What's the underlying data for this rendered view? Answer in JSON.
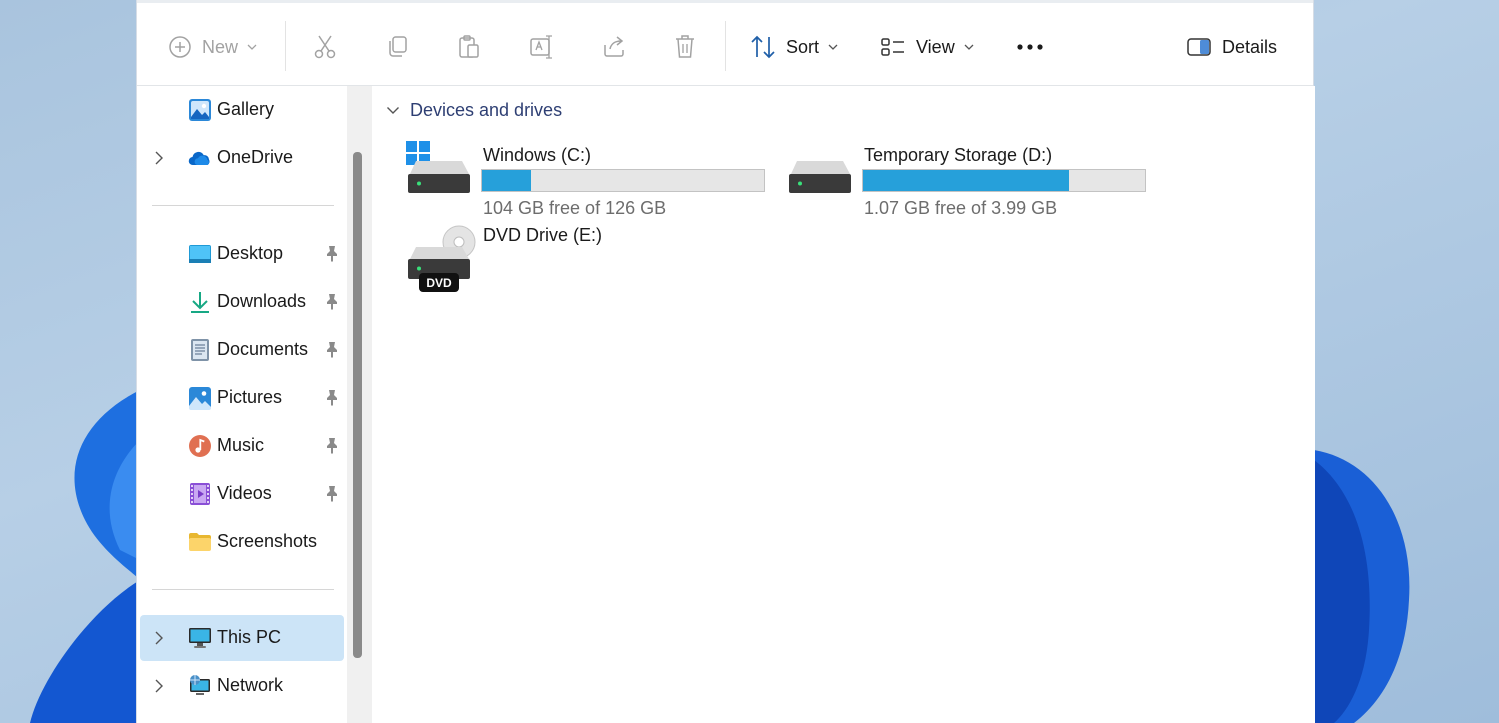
{
  "toolbar": {
    "new_label": "New",
    "sort_label": "Sort",
    "view_label": "View",
    "details_label": "Details",
    "icons": [
      "add-circle-icon",
      "cut-icon",
      "copy-icon",
      "paste-icon",
      "rename-icon",
      "share-icon",
      "delete-icon",
      "sort-icon",
      "view-icon",
      "more-icon",
      "details-pane-icon"
    ]
  },
  "nav": {
    "items": [
      {
        "label": "Gallery",
        "icon": "gallery-icon"
      },
      {
        "label": "OneDrive",
        "icon": "onedrive-icon"
      },
      {
        "label": "Desktop",
        "icon": "desktop-folder-icon",
        "pinned": true
      },
      {
        "label": "Downloads",
        "icon": "downloads-icon",
        "pinned": true
      },
      {
        "label": "Documents",
        "icon": "documents-icon",
        "pinned": true
      },
      {
        "label": "Pictures",
        "icon": "pictures-icon",
        "pinned": true
      },
      {
        "label": "Music",
        "icon": "music-icon",
        "pinned": true
      },
      {
        "label": "Videos",
        "icon": "videos-icon",
        "pinned": true
      },
      {
        "label": "Screenshots",
        "icon": "folder-icon"
      },
      {
        "label": "This PC",
        "icon": "this-pc-icon",
        "selected": true
      },
      {
        "label": "Network",
        "icon": "network-icon"
      }
    ]
  },
  "content": {
    "group_label": "Devices and drives",
    "drives": [
      {
        "name": "Windows (C:)",
        "free_text": "104 GB free of 126 GB",
        "used_fraction": 0.175
      },
      {
        "name": "Temporary Storage (D:)",
        "free_text": "1.07 GB free of 3.99 GB",
        "used_fraction": 0.732
      },
      {
        "name": "DVD Drive (E:)",
        "badge": "DVD"
      }
    ]
  },
  "colors": {
    "accent": "#26a0da",
    "selection": "#cce4f7",
    "group_header": "#2e3f73"
  }
}
